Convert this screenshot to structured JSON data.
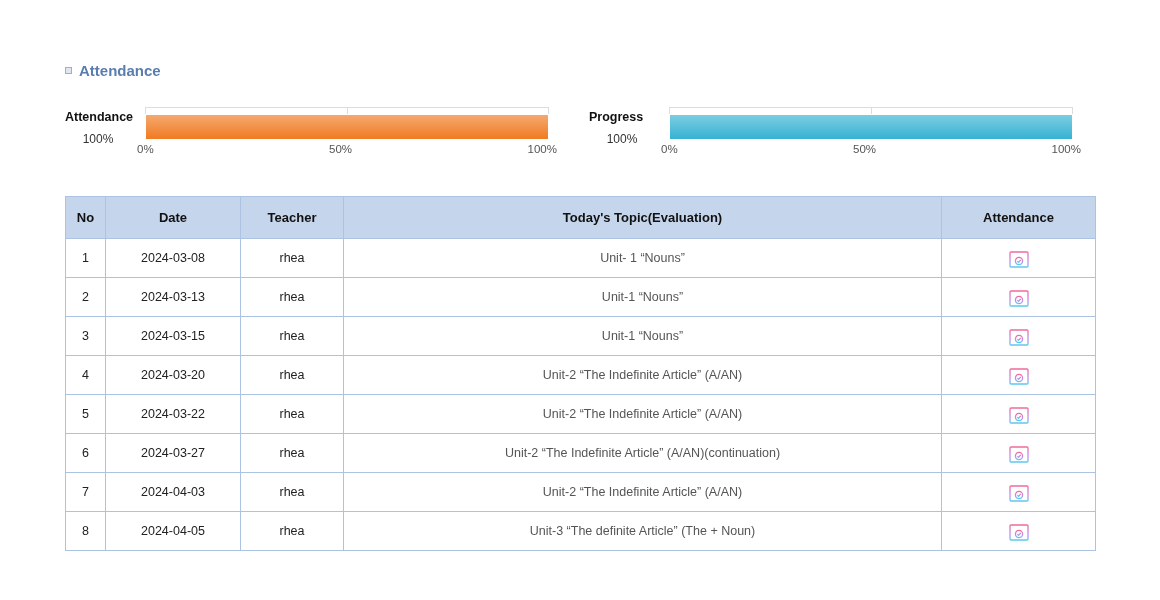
{
  "section_title": "Attendance",
  "meters": [
    {
      "label": "Attendance",
      "reading": "100%",
      "level": 1,
      "color": "#f07a22",
      "ticks": [
        "0%",
        "50%",
        "100%"
      ]
    },
    {
      "label": "Progress",
      "reading": "100%",
      "level": 1,
      "color": "#36b2d2",
      "ticks": [
        "0%",
        "50%",
        "100%"
      ]
    }
  ],
  "table": {
    "columns": [
      "No",
      "Date",
      "Teacher",
      "Today's Topic(Evaluation)",
      "Attendance"
    ],
    "rows": [
      {
        "no": "1",
        "date": "2024-03-08",
        "teacher": "rhea",
        "topic": "Unit- 1 “Nouns”"
      },
      {
        "no": "2",
        "date": "2024-03-13",
        "teacher": "rhea",
        "topic": "Unit-1 “Nouns”"
      },
      {
        "no": "3",
        "date": "2024-03-15",
        "teacher": "rhea",
        "topic": "Unit-1 “Nouns”"
      },
      {
        "no": "4",
        "date": "2024-03-20",
        "teacher": "rhea",
        "topic": "Unit-2 “The Indefinite Article” (A/AN)"
      },
      {
        "no": "5",
        "date": "2024-03-22",
        "teacher": "rhea",
        "topic": "Unit-2 “The Indefinite Article” (A/AN)"
      },
      {
        "no": "6",
        "date": "2024-03-27",
        "teacher": "rhea",
        "topic": "Unit-2 “The Indefinite Article” (A/AN)(continuation)"
      },
      {
        "no": "7",
        "date": "2024-04-03",
        "teacher": "rhea",
        "topic": "Unit-2 “The Indefinite Article” (A/AN)"
      },
      {
        "no": "8",
        "date": "2024-04-05",
        "teacher": "rhea",
        "topic": "Unit-3 “The definite Article” (The + Noun)"
      }
    ]
  }
}
